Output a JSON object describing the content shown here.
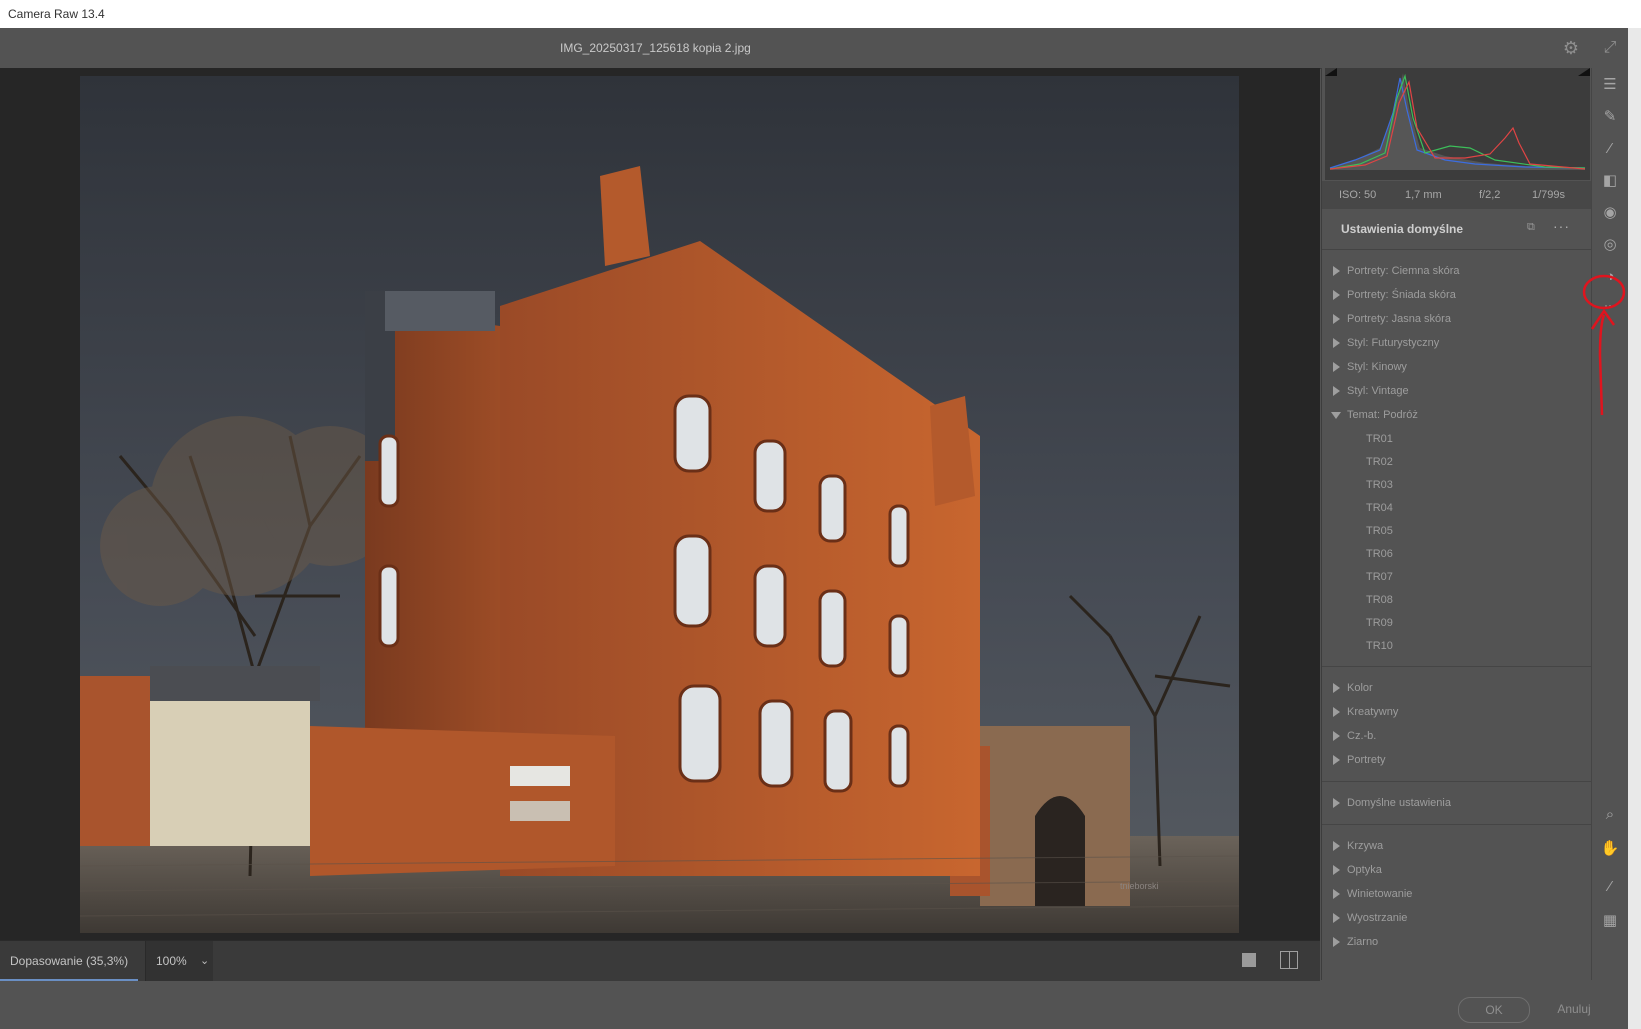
{
  "app": {
    "title": "Camera Raw 13.4"
  },
  "header": {
    "filename": "IMG_20250317_125618 kopia 2.jpg"
  },
  "photo": {
    "watermark": "tnieborski"
  },
  "exif": {
    "iso": "ISO: 50",
    "focal": "1,7 mm",
    "aperture": "f/2,2",
    "shutter": "1/799s"
  },
  "presets": {
    "title": "Ustawienia domyślne",
    "groups_top": [
      "Portrety: Ciemna skóra",
      "Portrety: Śniada skóra",
      "Portrety: Jasna skóra",
      "Styl: Futurystyczny",
      "Styl: Kinowy",
      "Styl: Vintage"
    ],
    "open_group": "Temat: Podróż",
    "open_items": [
      "TR01",
      "TR02",
      "TR03",
      "TR04",
      "TR05",
      "TR06",
      "TR07",
      "TR08",
      "TR09",
      "TR10"
    ],
    "groups_mid": [
      "Kolor",
      "Kreatywny",
      "Cz.-b.",
      "Portrety"
    ],
    "groups_default": [
      "Domyślne ustawienia"
    ],
    "groups_bottom": [
      "Krzywa",
      "Optyka",
      "Winietowanie",
      "Wyostrzanie",
      "Ziarno"
    ]
  },
  "bottom": {
    "zoom_fit": "Dopasowanie (35,3%)",
    "zoom_pct": "100%"
  },
  "footer": {
    "ok": "OK",
    "cancel": "Anuluj"
  },
  "colors": {
    "accent": "#6a8fc4",
    "annotation": "#e0141e",
    "brick": "#b8582c",
    "sky": "#3a3f47"
  }
}
